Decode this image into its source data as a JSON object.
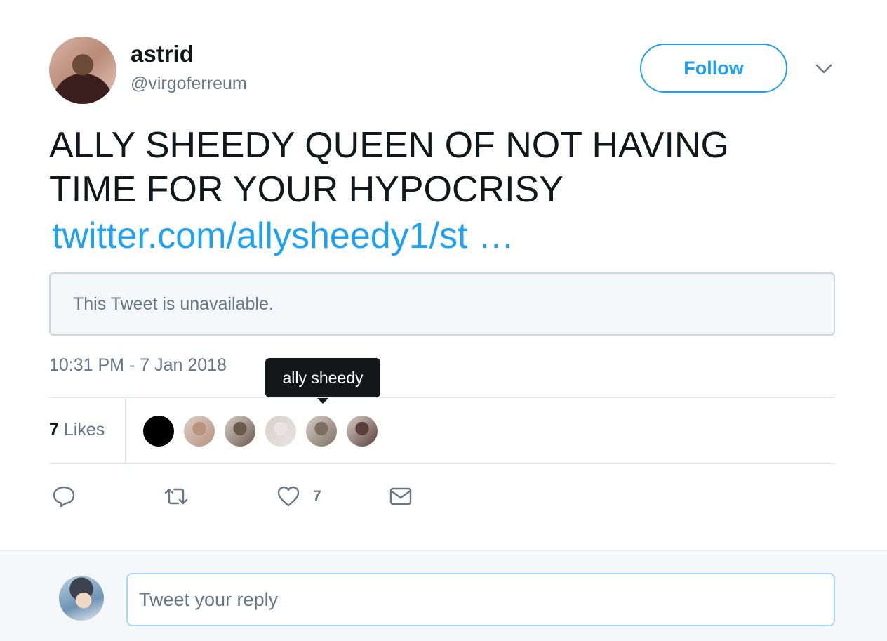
{
  "author": {
    "name": "astrid",
    "handle": "@virgoferreum"
  },
  "follow_button": {
    "label": "Follow"
  },
  "tweet": {
    "text_lines": [
      "ALLY SHEEDY QUEEN OF NOT HAVING",
      "TIME FOR YOUR HYPOCRISY"
    ],
    "link_text": "twitter.com/allysheedy1/st …",
    "quoted_unavailable": "This Tweet is unavailable.",
    "timestamp": "10:31 PM - 7 Jan 2018"
  },
  "likes": {
    "count": "7",
    "label": "Likes",
    "tooltip": "ally sheedy",
    "likers": [
      {
        "icon": "avatar",
        "color": "#000000"
      },
      {
        "icon": "avatar",
        "color": "#b9927e"
      },
      {
        "icon": "avatar",
        "color": "#6a5a4e"
      },
      {
        "icon": "avatar",
        "color": "#e9e3e3"
      },
      {
        "icon": "avatar",
        "color": "#7c6f62"
      },
      {
        "icon": "avatar",
        "color": "#5a3f3a"
      }
    ]
  },
  "actions": {
    "reply_icon": "reply-icon",
    "retweet_icon": "retweet-icon",
    "like_icon": "heart-icon",
    "like_count": "7",
    "dm_icon": "envelope-icon"
  },
  "reply_box": {
    "placeholder": "Tweet your reply"
  },
  "colors": {
    "accent": "#1da1f2",
    "secondary_text": "#657786",
    "tooltip_bg": "#14171a",
    "reply_bar_bg": "#f5f8fa"
  }
}
